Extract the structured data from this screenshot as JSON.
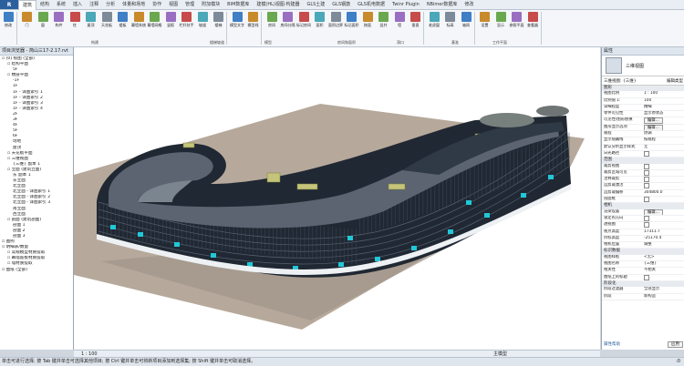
{
  "tabs": [
    "建筑",
    "结构",
    "系统",
    "插入",
    "注释",
    "分析",
    "体量和场地",
    "协作",
    "视图",
    "管理",
    "附加模块",
    "BIM数据库",
    "建模(HL)视图·构建器",
    "GLS土建",
    "GLS钢筋",
    "GLS机电数据",
    "Twinr Plugin",
    "NBimer数据库",
    "修改"
  ],
  "ribbon": {
    "buttons": [
      "修改",
      "门",
      "窗",
      "构件",
      "柱",
      "屋顶",
      "天花板",
      "楼板",
      "幕墙系统",
      "幕墙网格",
      "竖梃",
      "栏杆扶手",
      "坡道",
      "楼梯",
      "模型文字",
      "模型线",
      "房间",
      "房间分隔",
      "标记房间",
      "面积",
      "面积边界",
      "标记面积",
      "按面",
      "竖井",
      "墙",
      "垂直",
      "老虎窗",
      "标高",
      "轴网",
      "设置",
      "显示",
      "参照平面",
      "查看器"
    ],
    "groups": [
      "构建",
      "楼梯坡道",
      "模型",
      "房间和面积",
      "洞口",
      "基准",
      "工作平面"
    ]
  },
  "browser": {
    "title": "项目浏览器 - 简山三17-2.17.rvt",
    "nodes": [
      "[0] 视图 (全部)",
      "结构平面",
      "5F",
      "楼层平面",
      "-1F",
      "1F",
      "1F - 详图索引 1",
      "1F - 详图索引 2",
      "1F - 详图索引 3",
      "1F - 详图索引 4",
      "2F",
      "3F",
      "4F",
      "5F",
      "6F",
      "场地",
      "屋顶",
      "天花板平面",
      "三维视图",
      "{三维} 副本 1",
      "立面 (建筑立面)",
      "东 副本 1",
      "东立面",
      "北立面",
      "北立面 - 详图索引 1",
      "北立面 - 详图索引 2",
      "北立面 - 详图索引 3",
      "南立面",
      "西立面",
      "剖面 (建筑剖面)",
      "剖面 1",
      "剖面 2",
      "剖面 3",
      "图例",
      "明细表/数量",
      "常规模型材质提取",
      "幕墙嵌板材质提取",
      "墙材质提取",
      "图纸 (全部)"
    ]
  },
  "props": {
    "title": "属性",
    "type_name": "三维视图",
    "selector": "三维视图: {三维}",
    "edit_type": "编辑类型",
    "rows": [
      {
        "s": "图形"
      },
      {
        "k": "视图比例",
        "v": "1 : 100"
      },
      {
        "k": "比例值 1:",
        "v": "100"
      },
      {
        "k": "详细程度",
        "v": "精细"
      },
      {
        "k": "零件可见性",
        "v": "显示原状态"
      },
      {
        "k": "可见性/图形替换",
        "v": "编辑..."
      },
      {
        "k": "图形显示选项",
        "v": "编辑..."
      },
      {
        "k": "规程",
        "v": "协调"
      },
      {
        "k": "显示隐藏线",
        "v": "按规程"
      },
      {
        "k": "默认分析显示样式",
        "v": "无"
      },
      {
        "k": "日光路径",
        "v": ""
      },
      {
        "s": "范围"
      },
      {
        "k": "裁剪视图",
        "v": ""
      },
      {
        "k": "裁剪区域可见",
        "v": ""
      },
      {
        "k": "注释裁剪",
        "v": ""
      },
      {
        "k": "远剪裁激活",
        "v": ""
      },
      {
        "k": "远剪裁偏移",
        "v": "304800.0"
      },
      {
        "k": "剖面框",
        "v": ""
      },
      {
        "s": "相机"
      },
      {
        "k": "渲染设置",
        "v": "编辑..."
      },
      {
        "k": "锁定的方向",
        "v": ""
      },
      {
        "k": "透视图",
        "v": ""
      },
      {
        "k": "视点高度",
        "v": "17311.7"
      },
      {
        "k": "目标高度",
        "v": "-25170.4"
      },
      {
        "k": "相机位置",
        "v": "调整"
      },
      {
        "s": "标识数据"
      },
      {
        "k": "视图样板",
        "v": "<无>"
      },
      {
        "k": "视图名称",
        "v": "{三维}"
      },
      {
        "k": "相关性",
        "v": "不相关"
      },
      {
        "k": "图纸上的标题",
        "v": ""
      },
      {
        "s": "阶段化"
      },
      {
        "k": "阶段过滤器",
        "v": "全部显示"
      },
      {
        "k": "阶段",
        "v": "新构造"
      }
    ],
    "help": "属性帮助",
    "apply": "应用"
  },
  "viewbar": {
    "scale": "1 : 100",
    "model": "主模型"
  },
  "status": "单击可进行选择; 按 Tab 键并单击可选择其他项目; 按 Ctrl 键并单击可将新项目添加到选择集; 按 Shift 键并单击可取消选择。",
  "status_right": ":0"
}
